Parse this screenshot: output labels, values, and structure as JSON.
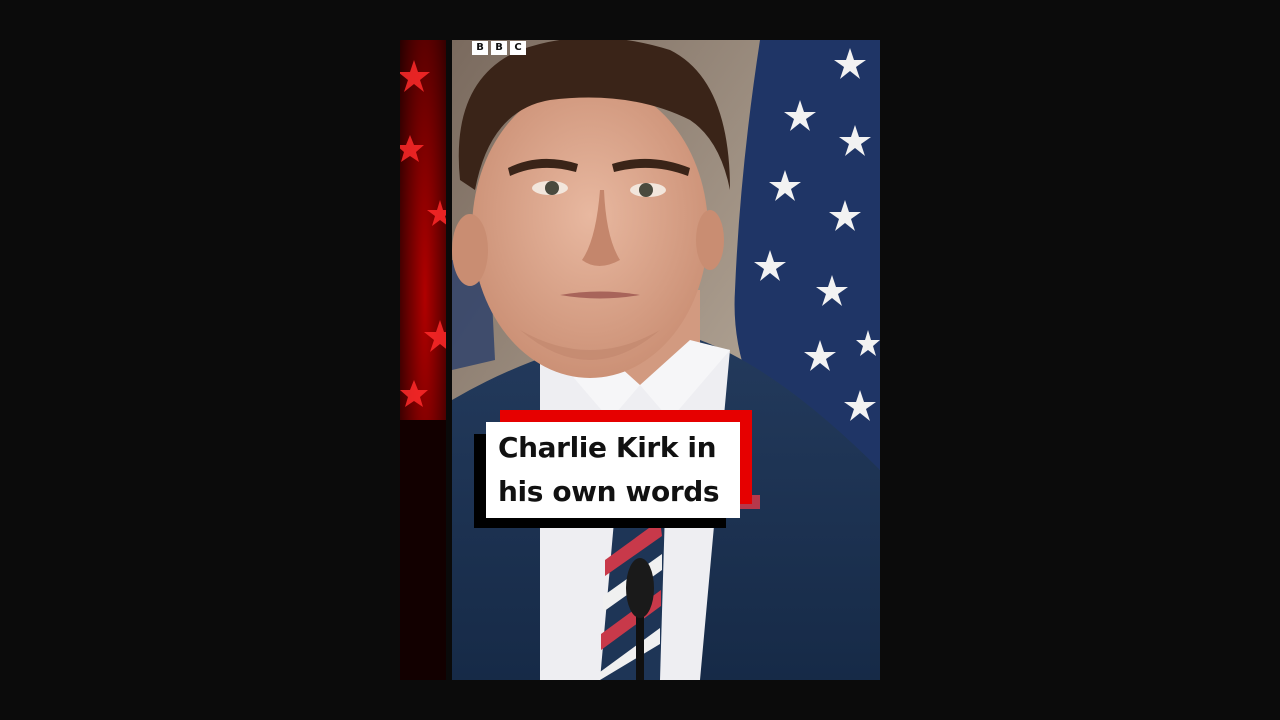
{
  "video": {
    "logo_letters": [
      "B",
      "B",
      "C"
    ],
    "caption_lines": [
      "Charlie Kirk in",
      "his own words"
    ]
  },
  "colors": {
    "page_background": "#0b0b0b",
    "caption_accent": "#e60000",
    "caption_background": "#ffffff",
    "caption_text": "#111111"
  }
}
